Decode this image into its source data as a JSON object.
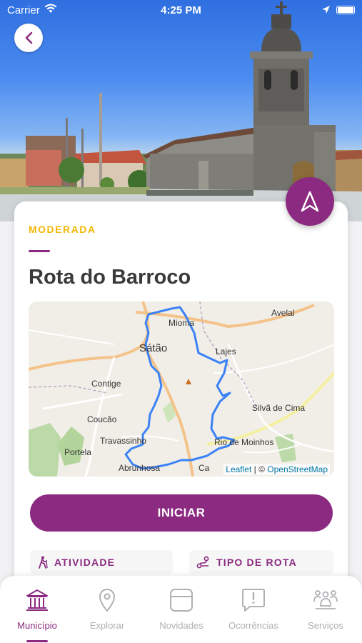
{
  "status_bar": {
    "carrier": "Carrier",
    "time": "4:25 PM",
    "wifi_icon": "wifi-icon",
    "location_icon": "location-arrow-icon",
    "battery_icon": "battery-icon"
  },
  "route": {
    "difficulty": "MODERADA",
    "title": "Rota do Barroco"
  },
  "map": {
    "places": [
      "Avelal",
      "Mioma",
      "Sátão",
      "Lajes",
      "Contige",
      "Silvã de Cima",
      "Coucão",
      "Travassinho",
      "Rio de Moinhos",
      "Portela",
      "Abrunhosa",
      "Ca"
    ],
    "attribution": {
      "leaflet": "Leaflet",
      "separator": " | © ",
      "osm": "OpenStreetMap"
    }
  },
  "actions": {
    "start_label": "INICIAR"
  },
  "info": {
    "activity_label": "ATIVIDADE",
    "route_type_label": "TIPO DE ROTA"
  },
  "tabs": [
    {
      "label": "Município",
      "icon": "municipality-building-icon",
      "active": true
    },
    {
      "label": "Explorar",
      "icon": "map-pin-icon",
      "active": false
    },
    {
      "label": "Novidades",
      "icon": "news-card-icon",
      "active": false
    },
    {
      "label": "Ocorrências",
      "icon": "alert-message-icon",
      "active": false
    },
    {
      "label": "Serviços",
      "icon": "services-people-icon",
      "active": false
    }
  ],
  "colors": {
    "primary": "#8b2a80",
    "difficulty": "#f2b705",
    "route_line": "#3b82f6"
  }
}
